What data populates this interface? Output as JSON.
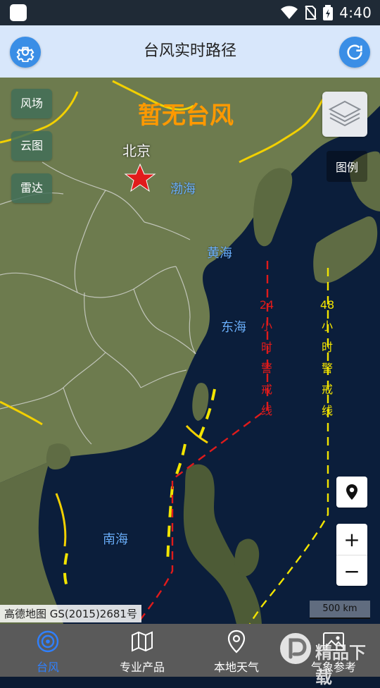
{
  "status_bar": {
    "time": "4:40",
    "icons": [
      "notification-square-icon",
      "wifi-icon",
      "no-sim-icon",
      "battery-charging-icon"
    ]
  },
  "header": {
    "title": "台风实时路径",
    "left_icon": "settings-gear-icon",
    "right_icon": "refresh-icon",
    "accent": "#3a8ee6"
  },
  "map": {
    "status_text": "暂无台风",
    "status_color": "#ff9900",
    "city_label": "北京",
    "seas": [
      "渤海",
      "黄海",
      "东海",
      "南海"
    ],
    "left_buttons": [
      "风场",
      "云图",
      "雷达"
    ],
    "legend_button": "图例",
    "warning_24h": "24小时警戒线",
    "warning_24h_color": "#e01b1b",
    "warning_48h": "48小时警戒线",
    "warning_48h_color": "#f2e400",
    "zoom_in": "+",
    "zoom_out": "−",
    "credit": "高德地图 GS(2015)2681号",
    "scale": "500 km"
  },
  "bottom_nav": {
    "items": [
      {
        "label": "台风",
        "icon": "typhoon-icon",
        "active": true
      },
      {
        "label": "专业产品",
        "icon": "map-icon",
        "active": false
      },
      {
        "label": "本地天气",
        "icon": "location-pin-icon",
        "active": false
      },
      {
        "label": "气象参考",
        "icon": "image-icon",
        "active": false
      }
    ],
    "active_color": "#2f80ff"
  },
  "watermark": {
    "text": "精品下载"
  }
}
